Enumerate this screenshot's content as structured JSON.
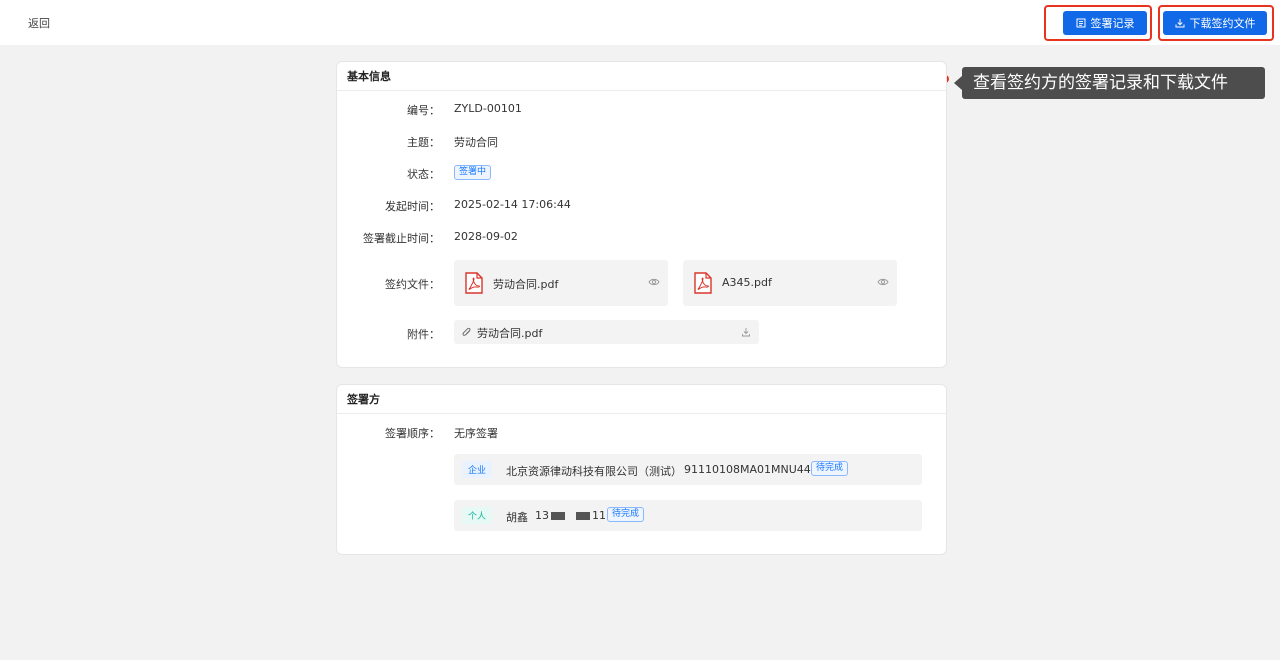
{
  "header": {
    "back_label": "返回",
    "sign_record_label": "签署记录",
    "download_label": "下载签约文件"
  },
  "tooltip": {
    "text": "查看签约方的签署记录和下载文件"
  },
  "basic_info": {
    "title": "基本信息",
    "fields": {
      "number_label": "编号：",
      "number_value": "ZYLD-00101",
      "subject_label": "主题：",
      "subject_value": "劳动合同",
      "status_label": "状态：",
      "status_value": "签署中",
      "start_time_label": "发起时间：",
      "start_time_value": "2025-02-14 17:06:44",
      "deadline_label": "签署截止时间：",
      "deadline_value": "2028-09-02",
      "files_label": "签约文件：",
      "attachment_label": "附件："
    },
    "files": [
      {
        "name": "劳动合同.pdf"
      },
      {
        "name": "A345.pdf"
      }
    ],
    "attachment": {
      "name": "劳动合同.pdf"
    }
  },
  "signers": {
    "title": "签署方",
    "order_label": "签署顺序：",
    "order_value": "无序签署",
    "list": [
      {
        "type": "企业",
        "name": "北京资源律动科技有限公司（测试）",
        "id": "91110108MA01MNU448",
        "status": "待完成"
      },
      {
        "type": "个人",
        "name": "胡鑫",
        "phone_prefix": "13",
        "phone_suffix": "11",
        "status": "待完成"
      }
    ]
  },
  "colors": {
    "primary": "#1169e8",
    "highlight": "#e8331e",
    "tag_blue": "#1677ff",
    "tag_enterprise_bg": "#e8f3ff",
    "tag_person_bg": "#e6f9f5",
    "tag_person_text": "#13b89a"
  }
}
